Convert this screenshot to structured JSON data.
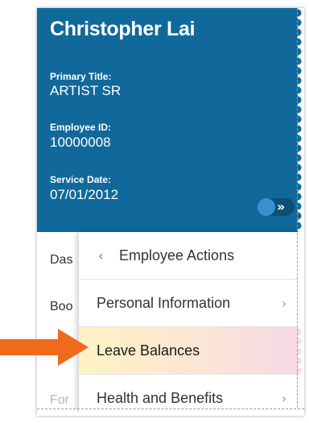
{
  "profile": {
    "name": "Christopher Lai",
    "primary_title_label": "Primary Title:",
    "primary_title_value": "ARTIST SR",
    "employee_id_label": "Employee ID:",
    "employee_id_value": "10000008",
    "service_date_label": "Service Date:",
    "service_date_value": "07/01/2012"
  },
  "toggle": {
    "chevron": "»",
    "icon": "toggle-switch"
  },
  "behind_menu": {
    "items": [
      "Das",
      "Boo",
      "For"
    ]
  },
  "panel": {
    "back_label": "Employee Actions",
    "back_chevron": "‹",
    "items": [
      {
        "label": "Personal Information",
        "chevron": "›"
      },
      {
        "label": "Leave Balances"
      },
      {
        "label": "Health and Benefits",
        "chevron": "›"
      }
    ]
  },
  "colors": {
    "header_bg": "#10699a",
    "arrow": "#f06a1d",
    "highlight_start": "#fdf3c4",
    "highlight_end": "#f7d6e8"
  }
}
